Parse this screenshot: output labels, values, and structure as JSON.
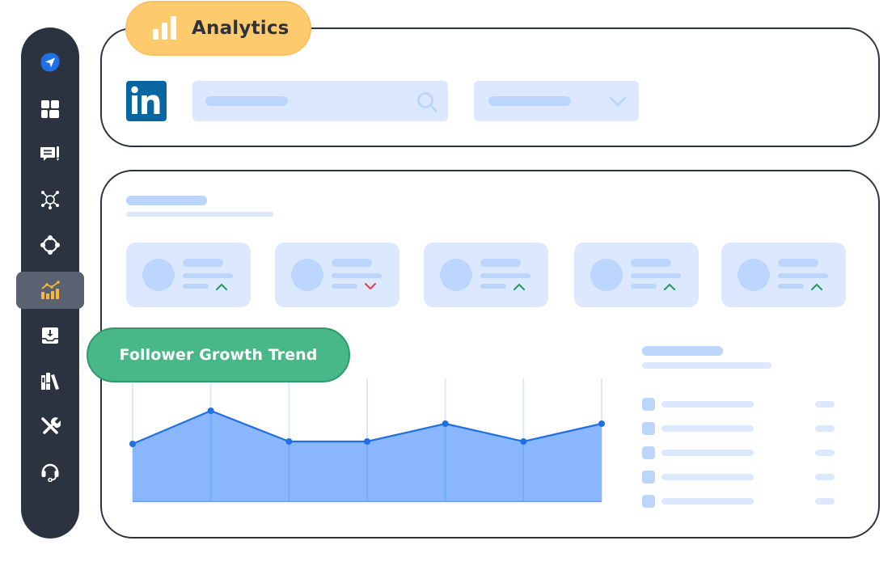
{
  "header": {
    "title": "Analytics",
    "platform": "LinkedIn",
    "platform_logo_text": "in"
  },
  "sidebar": {
    "items": [
      {
        "name": "send",
        "icon": "paper-plane-icon",
        "active": false
      },
      {
        "name": "dashboard",
        "icon": "dashboard-grid-icon",
        "active": false
      },
      {
        "name": "posts",
        "icon": "comment-edit-icon",
        "active": false
      },
      {
        "name": "network",
        "icon": "hub-network-icon",
        "active": false
      },
      {
        "name": "integrations",
        "icon": "connected-nodes-icon",
        "active": false
      },
      {
        "name": "analytics",
        "icon": "analytics-chart-icon",
        "active": true
      },
      {
        "name": "inbox",
        "icon": "inbox-download-icon",
        "active": false
      },
      {
        "name": "library",
        "icon": "library-books-icon",
        "active": false
      },
      {
        "name": "tools",
        "icon": "tools-icon",
        "active": false
      },
      {
        "name": "support",
        "icon": "headset-icon",
        "active": false
      }
    ]
  },
  "filters": {
    "search": {
      "icon": "search-icon",
      "value": ""
    },
    "dropdown": {
      "icon": "chevron-down-icon",
      "value": ""
    }
  },
  "stat_cards": [
    {
      "trend": "up"
    },
    {
      "trend": "down"
    },
    {
      "trend": "up"
    },
    {
      "trend": "up"
    },
    {
      "trend": "up"
    }
  ],
  "colors": {
    "sidebar_bg": "#2b3240",
    "active_icon": "#f4b63f",
    "brand_blue": "#1f6fe5",
    "trend_up": "#2e9a6a",
    "trend_down": "#e0474c",
    "analytics_pill": "#fdcb6e",
    "trend_pill": "#48b888",
    "linkedin": "#0a66a0"
  },
  "chart_section": {
    "title": "Follower Growth Trend"
  },
  "chart_data": {
    "type": "area",
    "title": "Follower Growth Trend",
    "xlabel": "",
    "ylabel": "",
    "x": [
      1,
      2,
      3,
      4,
      5,
      6,
      7
    ],
    "values": [
      71,
      112,
      74,
      74,
      96,
      74,
      96
    ],
    "ylim": [
      0,
      150
    ],
    "grid": "vertical",
    "legend": "none"
  },
  "side_list": {
    "rows": 5
  }
}
